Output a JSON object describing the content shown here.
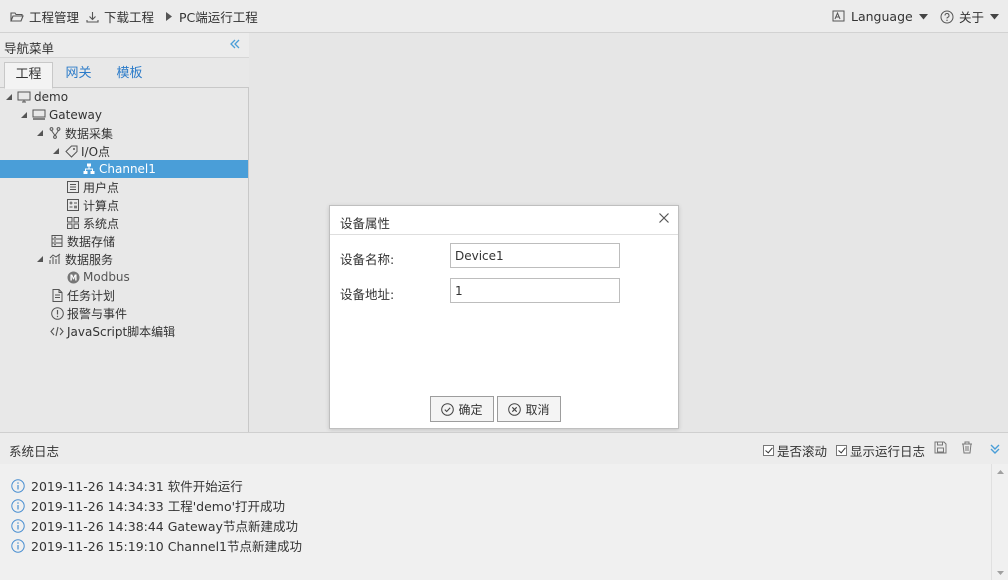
{
  "toolbar": {
    "project_manage": "工程管理",
    "download_project": "下载工程",
    "run_pc": "PC端运行工程",
    "language": "Language",
    "about": "关于"
  },
  "nav": {
    "title": "导航菜单",
    "tabs": [
      "工程",
      "网关",
      "模板"
    ],
    "tree": {
      "demo": "demo",
      "gateway": "Gateway",
      "data_collect": "数据采集",
      "io_points": "I/O点",
      "channel1": "Channel1",
      "user_points": "用户点",
      "calc_points": "计算点",
      "sys_points": "系统点",
      "data_storage": "数据存储",
      "data_service": "数据服务",
      "modbus": "Modbus",
      "task_plan": "任务计划",
      "alarm_event": "报警与事件",
      "js_edit": "JavaScript脚本编辑"
    }
  },
  "dialog": {
    "title": "设备属性",
    "name_label": "设备名称:",
    "name_value": "Device1",
    "addr_label": "设备地址:",
    "addr_value": "1",
    "ok": "确定",
    "cancel": "取消"
  },
  "log": {
    "title": "系统日志",
    "auto_scroll": "是否滚动",
    "show_run_log": "显示运行日志",
    "lines": [
      "2019-11-26 14:34:31 软件开始运行",
      "2019-11-26 14:34:33 工程'demo'打开成功",
      "2019-11-26 14:38:44 Gateway节点新建成功",
      "2019-11-26 15:19:10 Channel1节点新建成功"
    ]
  },
  "colors": {
    "accent": "#4a9ed8",
    "link": "#2b7bc9",
    "info": "#4a8fd1"
  }
}
